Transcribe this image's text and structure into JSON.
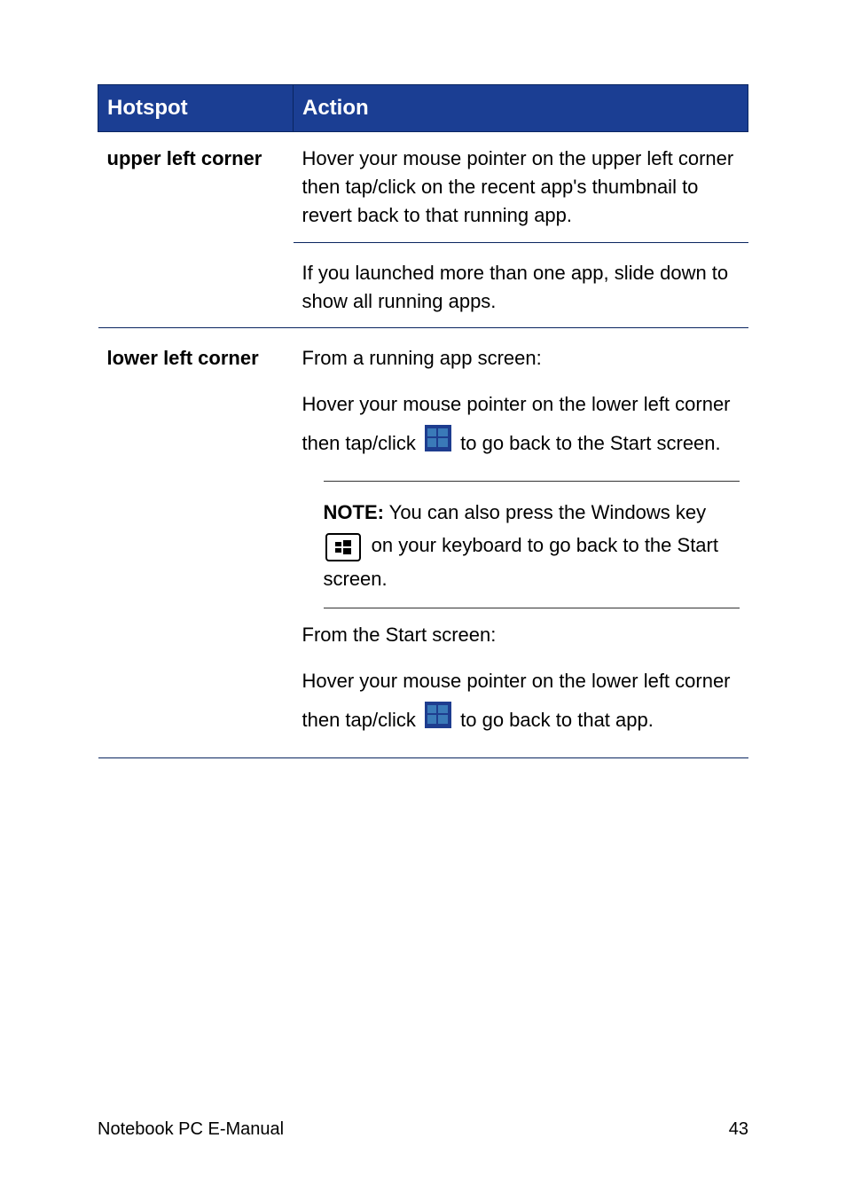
{
  "headers": {
    "hotspot": "Hotspot",
    "action": "Action"
  },
  "rows": {
    "upper_left": {
      "label": "upper left corner",
      "p1": "Hover your mouse pointer on the upper left corner then tap/click on the recent app's thumbnail to revert back to that running app.",
      "p2": "If you launched more than one app, slide down to show all running apps."
    },
    "lower_left": {
      "label": "lower left corner",
      "running_intro": "From a running app screen:",
      "running_pre": "Hover your mouse pointer on the lower left corner then tap/click ",
      "running_post": " to go back to the Start screen.",
      "note_label": "NOTE:",
      "note_pre": " You can also press the Windows key ",
      "note_post": " on your keyboard to go back to the Start screen.",
      "start_intro": "From the Start screen:",
      "start_pre": "Hover your mouse pointer on the lower left corner then tap/click ",
      "start_post": " to go back to that app."
    }
  },
  "footer": {
    "title": "Notebook PC E-Manual",
    "page": "43"
  }
}
